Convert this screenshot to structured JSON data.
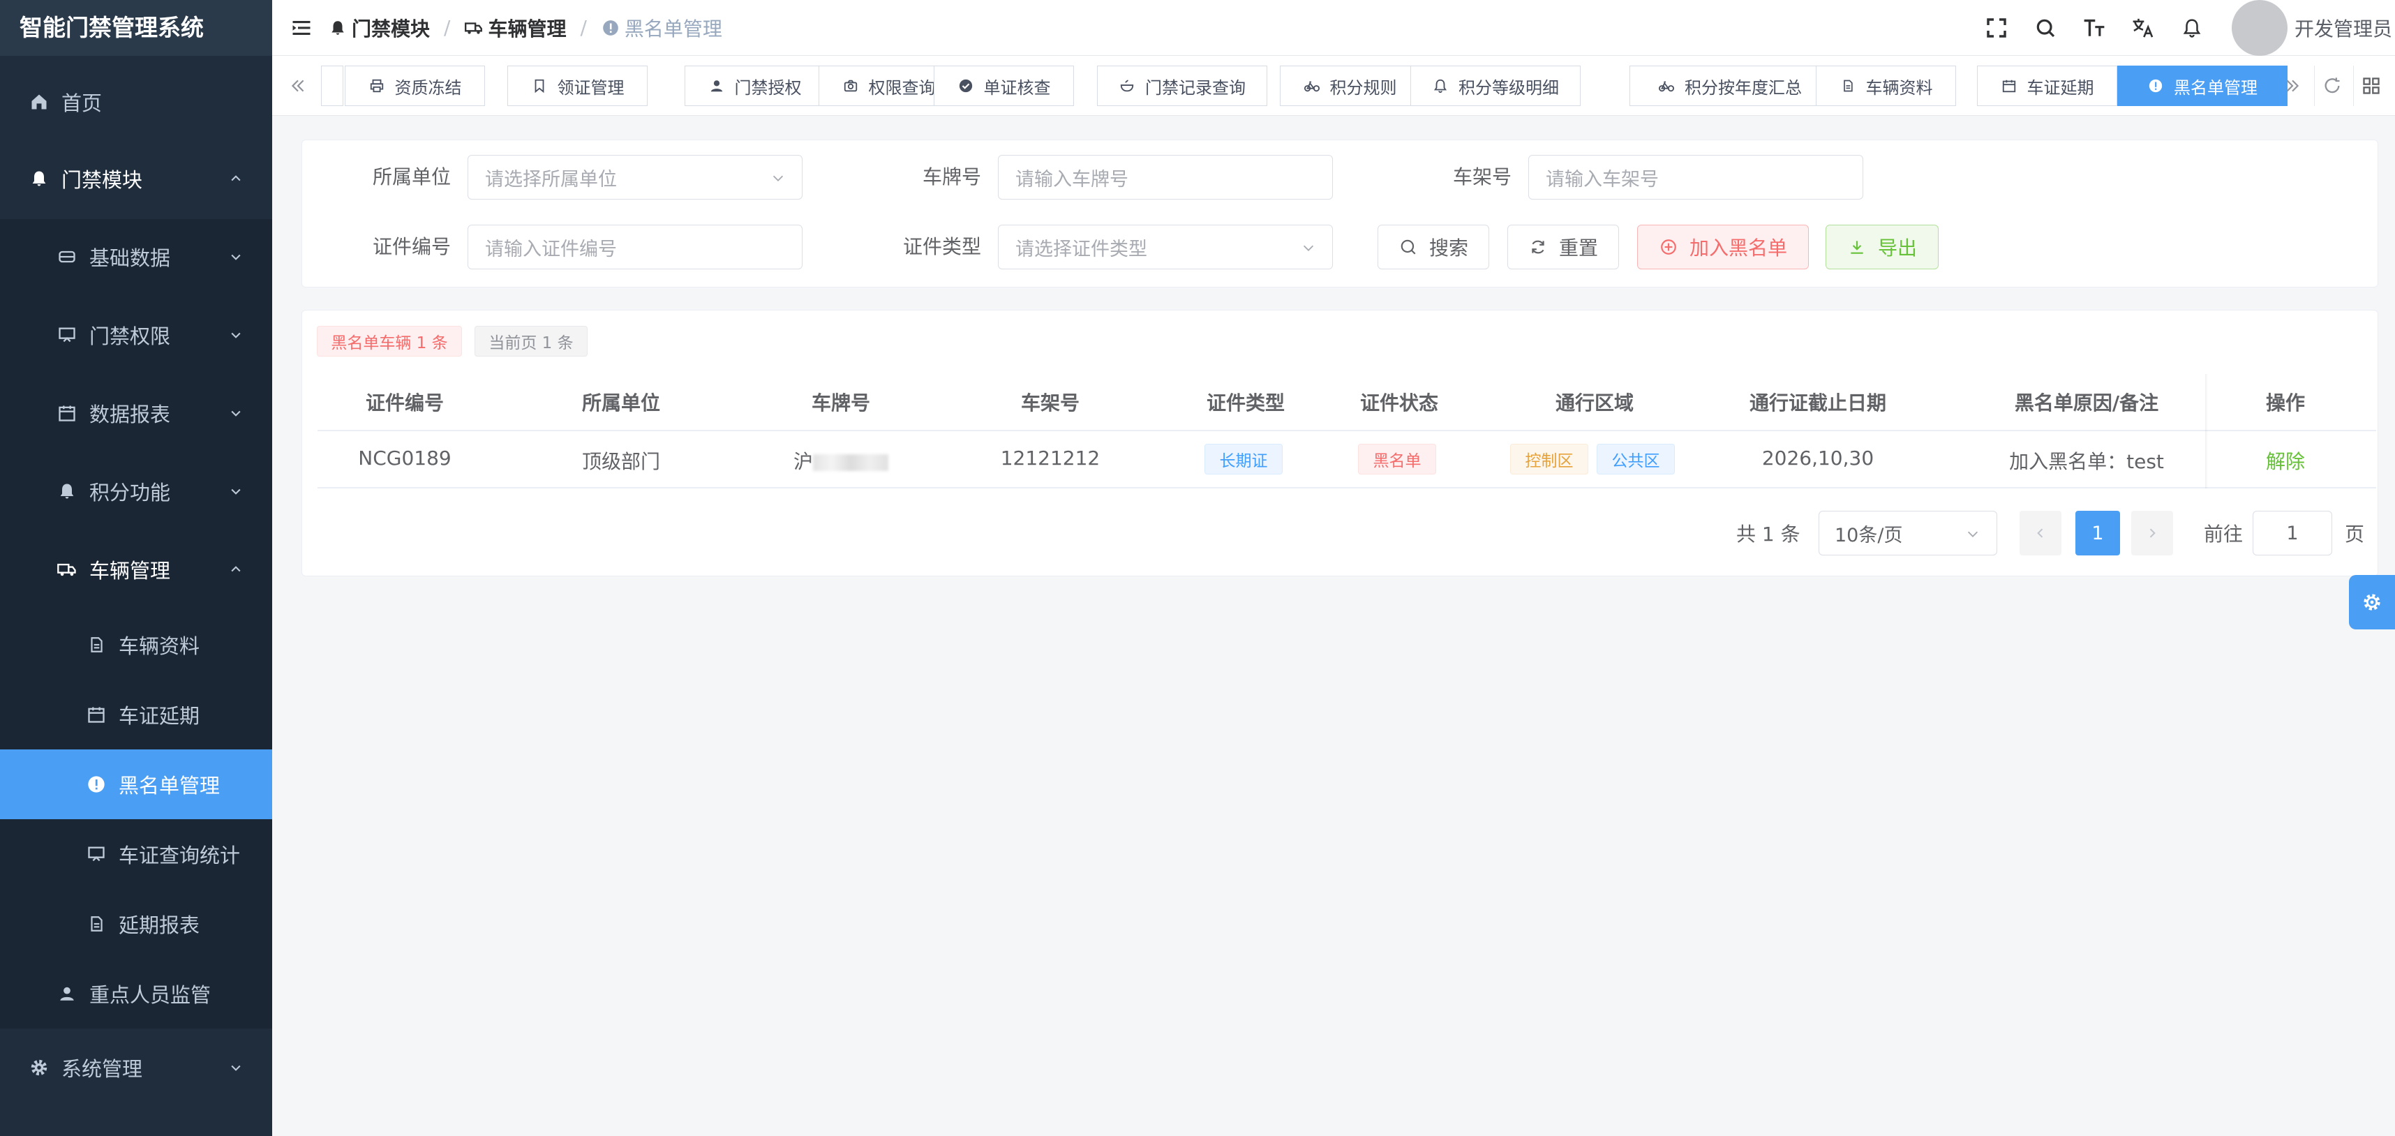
{
  "app": {
    "title": "智能门禁管理系统"
  },
  "sidebar": {
    "home": "首页",
    "access_module": "门禁模块",
    "basic_data": "基础数据",
    "access_rights": "门禁权限",
    "data_reports": "数据报表",
    "points": "积分功能",
    "vehicle_mgmt": "车辆管理",
    "vehicle_info": "车辆资料",
    "permit_extension": "车证延期",
    "blacklist_mgmt": "黑名单管理",
    "permit_stats": "车证查询统计",
    "extension_report": "延期报表",
    "key_person": "重点人员监管",
    "system_mgmt": "系统管理"
  },
  "breadcrumb": {
    "level1": "门禁模块",
    "sep": "/",
    "level2": "车辆管理",
    "level3": "黑名单管理"
  },
  "user": {
    "name": "开发管理员"
  },
  "tags": [
    {
      "label": "资质冻结",
      "icon": "printer-icon"
    },
    {
      "label": "领证管理",
      "icon": "bookmark-icon"
    },
    {
      "label": "门禁授权",
      "icon": "user-icon"
    },
    {
      "label": "权限查询",
      "icon": "camera-icon"
    },
    {
      "label": "单证核查",
      "icon": "check-circle-icon"
    },
    {
      "label": "门禁记录查询",
      "icon": "bowl-icon"
    },
    {
      "label": "积分规则",
      "icon": "bicycle-icon"
    },
    {
      "label": "积分等级明细",
      "icon": "bell-icon"
    },
    {
      "label": "积分按年度汇总",
      "icon": "bicycle-icon"
    },
    {
      "label": "车辆资料",
      "icon": "document-icon"
    },
    {
      "label": "车证延期",
      "icon": "calendar-icon"
    },
    {
      "label": "黑名单管理",
      "icon": "warning-icon"
    }
  ],
  "filters": {
    "org_label": "所属单位",
    "org_placeholder": "请选择所属单位",
    "plate_label": "车牌号",
    "plate_placeholder": "请输入车牌号",
    "frame_label": "车架号",
    "frame_placeholder": "请输入车架号",
    "cert_no_label": "证件编号",
    "cert_no_placeholder": "请输入证件编号",
    "cert_type_label": "证件类型",
    "cert_type_placeholder": "请选择证件类型",
    "search_btn": "搜索",
    "reset_btn": "重置",
    "add_blacklist_btn": "加入黑名单",
    "export_btn": "导出"
  },
  "summary": {
    "blacklist_count": "黑名单车辆 1 条",
    "page_count": "当前页 1 条"
  },
  "table": {
    "headers": [
      "证件编号",
      "所属单位",
      "车牌号",
      "车架号",
      "证件类型",
      "证件状态",
      "通行区域",
      "通行证截止日期",
      "黑名单原因/备注",
      "操作"
    ],
    "rows": [
      {
        "cert_no": "NCG0189",
        "org": "顶级部门",
        "plate": "沪",
        "frame": "12121212",
        "cert_type": "长期证",
        "cert_status": "黑名单",
        "area_1": "控制区",
        "area_2": "公共区",
        "expiry": "2026,10,30",
        "reason": "加入黑名单：test",
        "action": "解除"
      }
    ]
  },
  "pagination": {
    "total": "共 1 条",
    "page_size": "10条/页",
    "current_page": "1",
    "goto_label": "前往",
    "goto_value": "1",
    "page_suffix": "页"
  },
  "colors": {
    "sidebar_bg": "#1f2d3d",
    "accent": "#4a9ff5",
    "danger": "#f56c6c",
    "success": "#67c23a"
  }
}
